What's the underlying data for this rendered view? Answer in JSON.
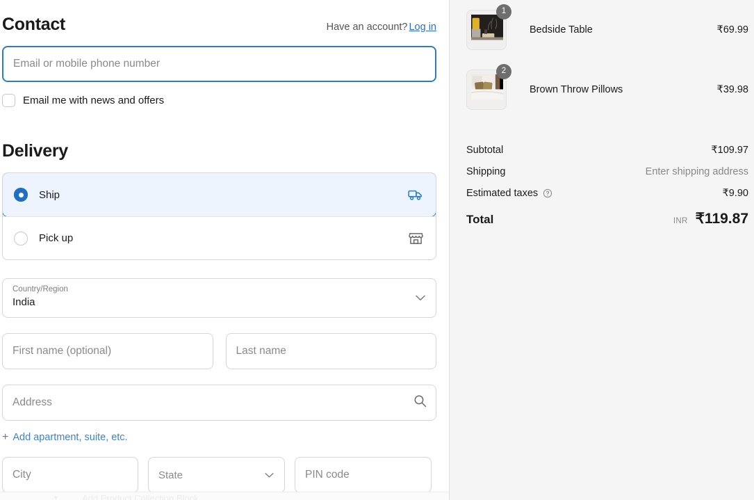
{
  "contact": {
    "title": "Contact",
    "account_prompt": "Have an account?",
    "login_link": "Log in",
    "email_placeholder": "Email or mobile phone number",
    "email_value": "",
    "newsletter_label": "Email me with news and offers",
    "newsletter_checked": false
  },
  "delivery": {
    "title": "Delivery",
    "methods": [
      {
        "label": "Ship",
        "icon": "truck-icon",
        "selected": true
      },
      {
        "label": "Pick up",
        "icon": "storefront-icon",
        "selected": false
      }
    ],
    "country": {
      "caption": "Country/Region",
      "value": "India"
    },
    "first_name_placeholder": "First name (optional)",
    "first_name_value": "",
    "last_name_placeholder": "Last name",
    "last_name_value": "",
    "address_placeholder": "Address",
    "address_value": "",
    "add_apartment_label": "Add apartment, suite, etc.",
    "add_apartment_prefix": "+",
    "city_placeholder": "City",
    "city_value": "",
    "state_placeholder": "State",
    "pin_placeholder": "PIN code",
    "pin_value": ""
  },
  "ghost": {
    "text": "Add Product Collection Block"
  },
  "summary": {
    "items": [
      {
        "name": "Bedside Table",
        "qty": "1",
        "price": "₹69.99"
      },
      {
        "name": "Brown Throw Pillows",
        "qty": "2",
        "price": "₹39.98"
      }
    ],
    "lines": [
      {
        "label": "Subtotal",
        "value": "₹109.97",
        "muted": false
      },
      {
        "label": "Shipping",
        "value": "Enter shipping address",
        "muted": true
      },
      {
        "label": "Estimated taxes",
        "value": "₹9.90",
        "muted": false,
        "info": true
      }
    ],
    "total": {
      "label": "Total",
      "currency": "INR",
      "amount": "₹119.87"
    }
  },
  "colors": {
    "accent_blue": "#2d7dbd",
    "link_blue": "#3f7fc1",
    "selected_bg": "#eef4fd",
    "panel_bg": "#f5f5f5",
    "muted_text": "#8a8a8a"
  }
}
